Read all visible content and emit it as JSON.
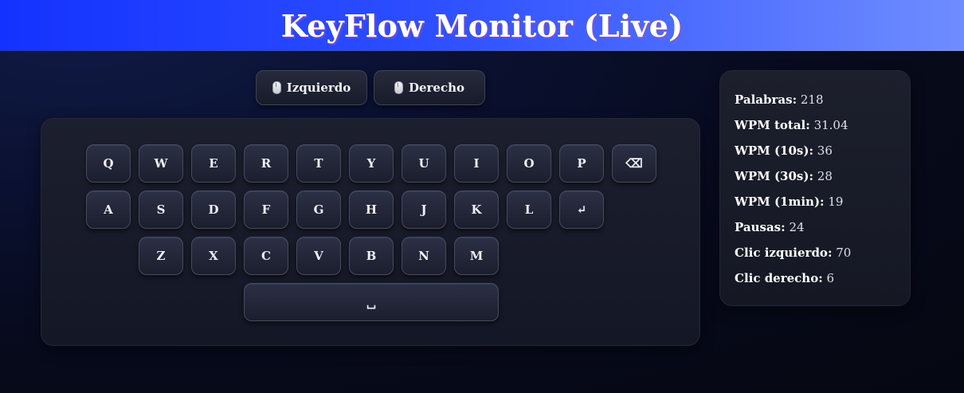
{
  "header": {
    "title": "KeyFlow Monitor (Live)"
  },
  "mouse_buttons": [
    {
      "icon": "mouse-icon",
      "label": "Izquierdo"
    },
    {
      "icon": "mouse-icon",
      "label": "Derecho"
    }
  ],
  "keyboard": {
    "row1": [
      "Q",
      "W",
      "E",
      "R",
      "T",
      "Y",
      "U",
      "I",
      "O",
      "P",
      "⌫"
    ],
    "row2": [
      "A",
      "S",
      "D",
      "F",
      "G",
      "H",
      "J",
      "K",
      "L",
      "↵"
    ],
    "row3": [
      "Z",
      "X",
      "C",
      "V",
      "B",
      "N",
      "M"
    ],
    "space": "␣"
  },
  "stats": [
    {
      "label": "Palabras:",
      "value": "218"
    },
    {
      "label": "WPM total:",
      "value": "31.04"
    },
    {
      "label": "WPM (10s):",
      "value": "36"
    },
    {
      "label": "WPM (30s):",
      "value": "28"
    },
    {
      "label": "WPM (1min):",
      "value": "19"
    },
    {
      "label": "Pausas:",
      "value": "24"
    },
    {
      "label": "Clic izquierdo:",
      "value": "70"
    },
    {
      "label": "Clic derecho:",
      "value": "6"
    }
  ]
}
